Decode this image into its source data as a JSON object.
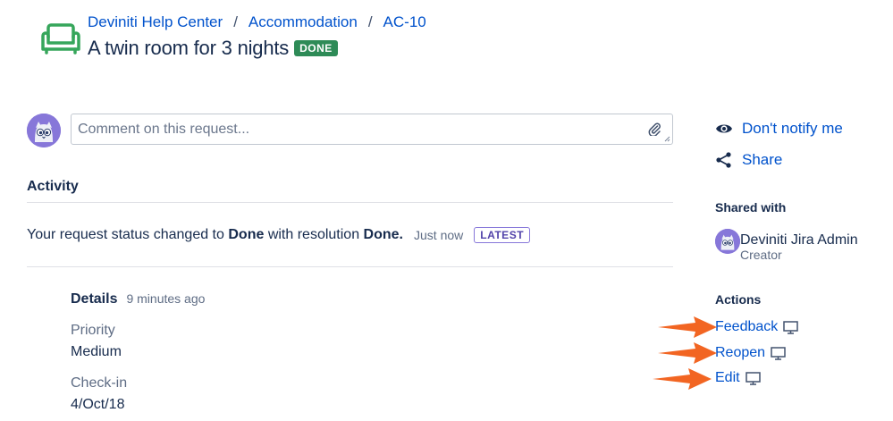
{
  "breadcrumb": {
    "items": [
      "Deviniti Help Center",
      "Accommodation",
      "AC-10"
    ],
    "separator": "/"
  },
  "request": {
    "title": "A twin room for 3 nights",
    "status": "DONE",
    "status_color": "#2e8b57",
    "icon": "sofa-icon"
  },
  "comment": {
    "placeholder": "Comment on this request..."
  },
  "activity": {
    "heading": "Activity",
    "event_prefix": "Your request status changed to",
    "event_status": "Done",
    "event_middle": "with resolution",
    "event_resolution": "Done.",
    "event_time": "Just now",
    "latest_badge": "LATEST"
  },
  "details": {
    "title": "Details",
    "time": "9 minutes ago",
    "fields": [
      {
        "label": "Priority",
        "value": "Medium"
      },
      {
        "label": "Check-in",
        "value": "4/Oct/18"
      }
    ]
  },
  "sidebar": {
    "notify": {
      "label": "Don't notify me",
      "icon": "eye-icon"
    },
    "share": {
      "label": "Share",
      "icon": "share-icon"
    },
    "shared_with_heading": "Shared with",
    "shared_user": {
      "name": "Deviniti Jira Admin",
      "role": "Creator"
    },
    "actions_heading": "Actions",
    "actions": [
      {
        "label": "Feedback",
        "icon": "monitor-icon"
      },
      {
        "label": "Reopen",
        "icon": "monitor-icon"
      },
      {
        "label": "Edit",
        "icon": "monitor-icon"
      }
    ]
  },
  "colors": {
    "link": "#0052cc",
    "text": "#172b4d",
    "arrow": "#f26522",
    "avatar": "#8777d9"
  }
}
